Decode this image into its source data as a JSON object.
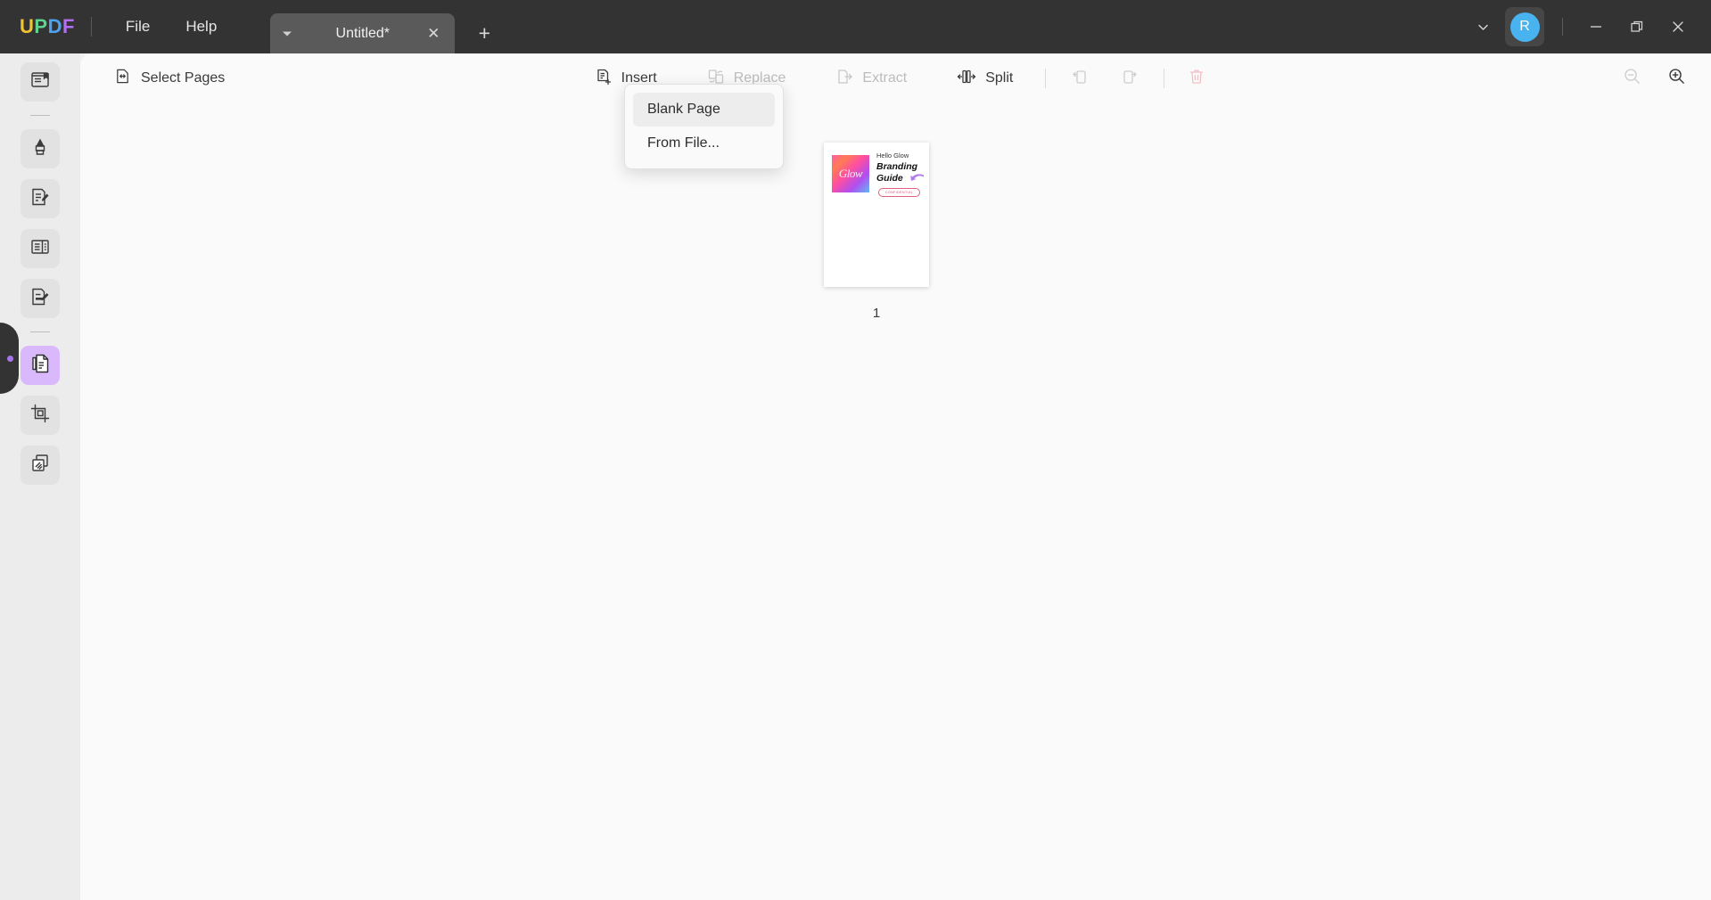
{
  "app": {
    "logo_letters": [
      "U",
      "P",
      "D",
      "F"
    ],
    "logo_colors": [
      "#f0c330",
      "#5fd38d",
      "#4da3f0",
      "#b36ef5"
    ],
    "accent": "#a875e8"
  },
  "titlebar": {
    "menus": [
      {
        "label": "File",
        "name": "menu-file"
      },
      {
        "label": "Help",
        "name": "menu-help"
      }
    ],
    "tab": {
      "title": "Untitled*",
      "close_glyph": "✕",
      "caret_name": "tab-dropdown-caret"
    },
    "new_tab_glyph": "+",
    "chevron_glyph": "⌄",
    "avatar_initial": "R",
    "avatar_color": "#49b3ef",
    "window": {
      "minimize_glyph": "—",
      "maximize_glyph": "❐",
      "close_glyph": "✕"
    }
  },
  "sidebar": {
    "items": [
      {
        "name": "sidebar-item-reader",
        "icon": "book-reader-icon",
        "state": "normal"
      },
      {
        "name": "sidebar-separator-1",
        "icon": "separator",
        "state": "separator"
      },
      {
        "name": "sidebar-item-markup",
        "icon": "highlighter-pen-icon",
        "state": "normal"
      },
      {
        "name": "sidebar-item-edit-pdf",
        "icon": "edit-document-icon",
        "state": "normal"
      },
      {
        "name": "sidebar-item-page-layout",
        "icon": "page-layout-icon",
        "state": "normal"
      },
      {
        "name": "sidebar-item-fill-sign",
        "icon": "fill-and-sign-icon",
        "state": "normal"
      },
      {
        "name": "sidebar-separator-2",
        "icon": "separator",
        "state": "separator"
      },
      {
        "name": "sidebar-item-organize-pages",
        "icon": "organize-pages-icon",
        "state": "active"
      },
      {
        "name": "sidebar-item-crop",
        "icon": "crop-icon",
        "state": "normal"
      },
      {
        "name": "sidebar-item-batch",
        "icon": "batch-pages-icon",
        "state": "normal"
      }
    ]
  },
  "toolbar": {
    "select_pages_label": "Select Pages",
    "select_pages_icon": "select-pages-icon",
    "tools": [
      {
        "label": "Insert",
        "icon": "insert-page-icon",
        "disabled": false
      },
      {
        "label": "Replace",
        "icon": "replace-page-icon",
        "disabled": true
      },
      {
        "label": "Extract",
        "icon": "extract-page-icon",
        "disabled": true
      },
      {
        "label": "Split",
        "icon": "split-page-icon",
        "disabled": false
      }
    ],
    "icon_tools": [
      {
        "name": "rotate-left-button",
        "icon": "rotate-left-icon",
        "disabled": true
      },
      {
        "name": "rotate-right-button",
        "icon": "rotate-right-icon",
        "disabled": true
      },
      {
        "name": "delete-page-button",
        "icon": "trash-icon",
        "disabled": true,
        "color": "#f0bcc0"
      }
    ],
    "zoom_out_icon": "zoom-out-icon",
    "zoom_in_icon": "zoom-in-icon"
  },
  "insert_menu": {
    "items": [
      {
        "label": "Blank Page",
        "highlighted": true
      },
      {
        "label": "From File...",
        "highlighted": false
      }
    ]
  },
  "canvas": {
    "page": {
      "number": "1",
      "thumbnail": {
        "logo_text": "Glow",
        "heading": "Hello Glow",
        "title_line1": "Branding",
        "title_line2": "Guide",
        "badge": "CONFIDENTIAL",
        "arrow_color": "#b07ee8",
        "badge_color": "#d44a6e"
      }
    }
  }
}
